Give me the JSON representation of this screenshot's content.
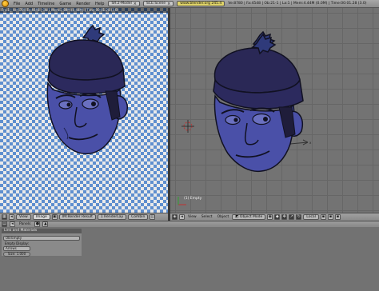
{
  "top_header": {
    "menus": [
      "File",
      "Add",
      "Timeline",
      "Game",
      "Render",
      "Help"
    ],
    "screen_field": "SR:2-Model",
    "scene_field": "SCE:Scene",
    "url": "www.blender.org 245.4",
    "stats": "Ve:8780 | Fa:4548 | Ob:21-1 | La:1 | Mem:4.44M (0.0M) | Time:00:01.28 (3.0)"
  },
  "image_editor": {
    "render_info": "Fra:1 | Ve:6780 Fa:4648 | Ob:1 Mem:2.89M (0.44M) | Time:00:01.28 (3.0)",
    "header": {
      "view_label": "View",
      "image_label": "Image",
      "image_name": "IM:Render Result",
      "render_layer": "1 RenderLay",
      "pass": "Combin"
    }
  },
  "viewport": {
    "object_label": "(1) Empty",
    "header": {
      "menus": [
        "View",
        "Select",
        "Object"
      ],
      "mode": "Object Mode",
      "orientation": "Local"
    }
  },
  "buttons": {
    "header": {
      "panels_label": "Panels"
    },
    "panel": {
      "title": "Link and Materials",
      "ob_field": "OB:Empty",
      "empty_display_label": "Empty Display:",
      "display_type": "Arrows",
      "size_field": "Size: 1.000"
    }
  },
  "colors": {
    "hat": "#2a2856",
    "skin": "#4a50a8",
    "outline": "#111122",
    "checker_blue": "#5f8fcf"
  }
}
